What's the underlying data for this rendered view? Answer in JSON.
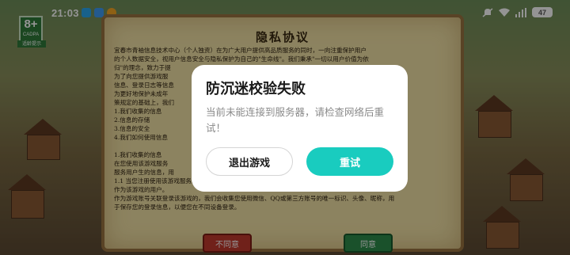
{
  "status_bar": {
    "time": "21:03",
    "battery": "47",
    "icons": [
      "qq-icon",
      "app-icon",
      "weibo-icon",
      "mute-icon",
      "wifi-icon",
      "signal-icon"
    ]
  },
  "age_badge": {
    "rating": "8+",
    "sub": "CADPA",
    "tip": "适龄提示"
  },
  "privacy": {
    "title": "隐私协议",
    "lines": [
      "宜春市青袖信息技术中心（个人独资）在为广大用户提供高品质服务的同时，一向注重保护用户",
      "的个人数据安全，视用户信息安全与隐私保护为自己的\"生命线\"。我们秉承\"一切以用户价值为依",
      "归\"的理念，致力于提",
      "为了向您提供游戏服",
      "信息、登录日志等信息",
      "为更好地保护未成年",
      "策规定的基础上，我们",
      "1.我们收集的信息",
      "2.信息的存储",
      "3.信息的安全",
      "4.我们如何使用信息",
      "",
      "1.我们收集的信息",
      "在您使用该游戏服务",
      "服务用户生的信息，用",
      "1.1 当您注册使用该游戏服务的用户时，我们会收集您的",
      "作为该游戏的用户。",
      "作为游戏账号关联登录该游戏的，我们会收集您使用微信、QQ或第三方账号的唯一标识、头像、昵称，用",
      "于保存您的登录信息，以便您在不同设备登录。"
    ],
    "disagree_label": "不同意",
    "agree_label": "同意"
  },
  "dialog": {
    "title": "防沉迷校验失败",
    "message": "当前未能连接到服务器，请检查网络后重试！",
    "exit_label": "退出游戏",
    "retry_label": "重试"
  }
}
